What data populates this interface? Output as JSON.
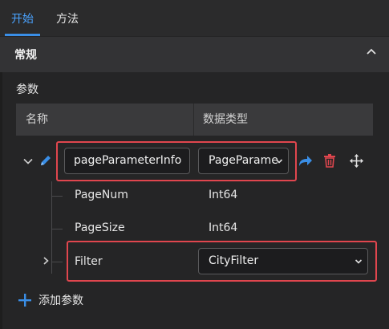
{
  "tabs": [
    {
      "label": "开始",
      "active": true
    },
    {
      "label": "方法",
      "active": false
    }
  ],
  "section": {
    "title": "常规",
    "collapsed": false
  },
  "params_label": "参数",
  "table": {
    "headers": [
      "名称",
      "数据类型"
    ]
  },
  "rows": {
    "parent": {
      "name": "pageParameterInfo",
      "type": "PageParame",
      "expanded": true
    },
    "children": [
      {
        "name": "PageNum",
        "type": "Int64"
      },
      {
        "name": "PageSize",
        "type": "Int64"
      }
    ],
    "filter": {
      "name": "Filter",
      "type": "CityFilter",
      "expanded": false
    }
  },
  "add_button": {
    "label": "添加参数"
  },
  "colors": {
    "accent": "#3a8ee6",
    "highlight": "#e0464e",
    "delete": "#e0464e",
    "background": "#252526"
  },
  "icons": {
    "expand": "chevron-down-icon",
    "edit": "pencil-icon",
    "redo": "redo-arrow-icon",
    "delete": "trash-icon",
    "move": "move-arrows-icon",
    "collapse": "chevron-up-icon",
    "add": "plus-icon"
  }
}
